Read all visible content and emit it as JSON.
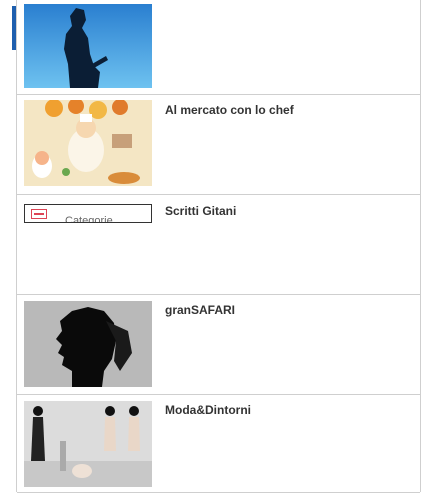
{
  "items": [
    {
      "title": ""
    },
    {
      "title": "Al mercato con lo chef"
    },
    {
      "title": "Scritti Gitani",
      "category_label": "Categorie"
    },
    {
      "title": "granSAFARI"
    },
    {
      "title": "Moda&Dintorni"
    }
  ],
  "colors": {
    "accent_blue": "#1e5fae",
    "divider": "#cfcfcf",
    "category_icon": "#d44455"
  }
}
